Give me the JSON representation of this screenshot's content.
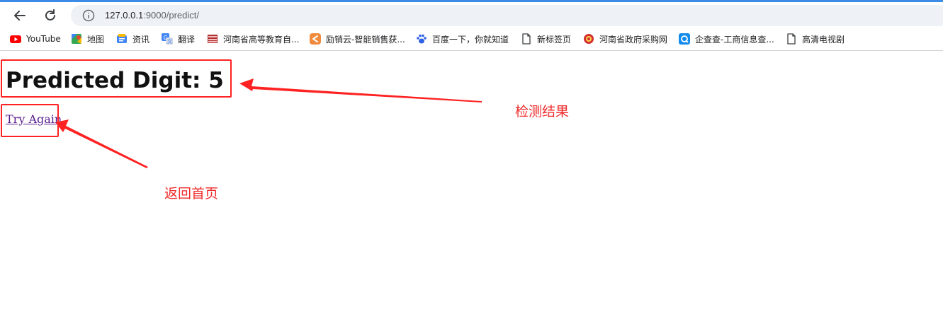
{
  "browser": {
    "url_host": "127.0.0.1",
    "url_rest": ":9000/predict/",
    "accent_color": "#3c8ce7"
  },
  "bookmarks": [
    {
      "label": "YouTube",
      "icon": "youtube-icon"
    },
    {
      "label": "地图",
      "icon": "maps-icon"
    },
    {
      "label": "资讯",
      "icon": "news-icon"
    },
    {
      "label": "翻译",
      "icon": "translate-icon"
    },
    {
      "label": "河南省高等教育自...",
      "icon": "education-icon"
    },
    {
      "label": "励销云-智能销售获...",
      "icon": "lixiaoyun-icon"
    },
    {
      "label": "百度一下，你就知道",
      "icon": "baidu-icon"
    },
    {
      "label": "新标签页",
      "icon": "page-icon"
    },
    {
      "label": "河南省政府采购网",
      "icon": "gov-emblem-icon"
    },
    {
      "label": "企查查-工商信息查...",
      "icon": "qichacha-icon"
    },
    {
      "label": "高清电视剧",
      "icon": "page-icon"
    }
  ],
  "page": {
    "heading": "Predicted Digit: 5",
    "link_label": "Try Again"
  },
  "annotations": {
    "result_label": "检测结果",
    "return_label": "返回首页",
    "color": "#f02a2a"
  }
}
